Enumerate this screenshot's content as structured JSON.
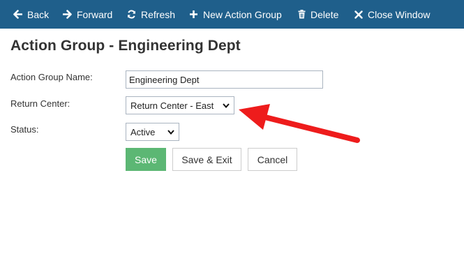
{
  "toolbar": {
    "back": "Back",
    "forward": "Forward",
    "refresh": "Refresh",
    "new_action_group": "New Action Group",
    "delete": "Delete",
    "close_window": "Close Window",
    "background_color": "#1f5f8b"
  },
  "page": {
    "title": "Action Group - Engineering Dept"
  },
  "form": {
    "name_label": "Action Group Name:",
    "name_value": "Engineering Dept",
    "return_center_label": "Return Center:",
    "return_center_value": "Return Center - East",
    "status_label": "Status:",
    "status_value": "Active"
  },
  "buttons": {
    "save": "Save",
    "save_exit": "Save & Exit",
    "cancel": "Cancel",
    "save_color": "#5cb774"
  },
  "annotation": {
    "arrow_color": "#ee1c1c",
    "arrow_icon": "red-annotation-arrow-icon"
  }
}
